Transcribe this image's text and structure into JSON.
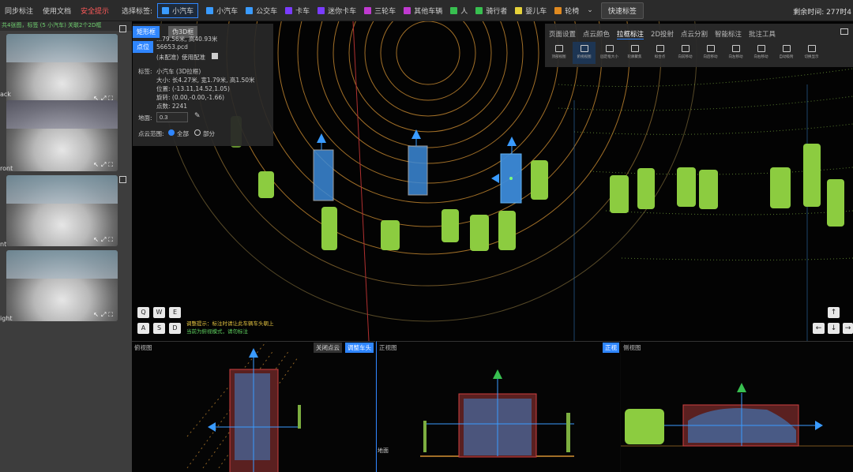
{
  "topbar": {
    "links": [
      "同步标注",
      "使用文档",
      "安全提示"
    ],
    "select_label": "选择标签:",
    "tags": [
      {
        "label": "小汽车",
        "color": "#3a9bff",
        "active": true
      },
      {
        "label": "小汽车",
        "color": "#3a9bff",
        "active": false
      },
      {
        "label": "公交车",
        "color": "#3a9bff",
        "active": false
      },
      {
        "label": "卡车",
        "color": "#7a3cff",
        "active": false
      },
      {
        "label": "迷你卡车",
        "color": "#7a3cff",
        "active": false
      },
      {
        "label": "三轮车",
        "color": "#c03ad0",
        "active": false
      },
      {
        "label": "其他车辆",
        "color": "#c03ad0",
        "active": false
      },
      {
        "label": "人",
        "color": "#38c050",
        "active": false
      },
      {
        "label": "骑行者",
        "color": "#38c050",
        "active": false
      },
      {
        "label": "婴儿车",
        "color": "#e6d23a",
        "active": false
      },
      {
        "label": "轮椅",
        "color": "#e08a20",
        "active": false
      }
    ],
    "quick_tag": "快速标签",
    "remaining": "剩余时间: 277时4"
  },
  "left": {
    "header": "共4张图，标签 (5 小汽车) 关联2个2D框",
    "cameras": [
      {
        "label": "ack"
      },
      {
        "label": "ront"
      },
      {
        "label": "nt"
      },
      {
        "label": "ight"
      }
    ]
  },
  "info": {
    "tab_rect": "矩形框",
    "tab_3d": "伪3D框",
    "tab_point": "点位",
    "dims": "...79.56米, 高40.93米",
    "file": "56653.pcd",
    "unmatched": "(未配准)",
    "use_match": "使用配准",
    "tag_label": "标签:",
    "tag_value": "小汽车 (3D拉框)",
    "size": "大小: 长4.27米, 宽1.79米, 高1.50米",
    "position": "位置: (-13.11,14.52,1.05)",
    "rotation": "旋转: (0.00,-0.00,-1.66)",
    "points": "点数: 2241",
    "ground_label": "地面:",
    "ground_value": "0.3",
    "range_label": "点云范围:",
    "range_all": "全部",
    "range_part": "部分"
  },
  "tools": {
    "tabs": [
      "页面设置",
      "点云颜色",
      "拉框标注",
      "2D投射",
      "点云分割",
      "智能标注",
      "批注工具"
    ],
    "items": [
      "顶部视图",
      "俯视视图",
      "固定框大小",
      "轮廓聚焦",
      "拟合点",
      "向前移动",
      "向后移动",
      "向左移动",
      "向右移动",
      "自动吸附",
      "切换显示"
    ]
  },
  "keys": [
    "Q",
    "W",
    "E",
    "A",
    "S",
    "D"
  ],
  "arrow_keys": [
    "↑",
    "←",
    "↓",
    "→"
  ],
  "hint": [
    "调整提示：标注时请让此车辆车头朝上",
    "当前为俯视模式，请勿标注"
  ],
  "views": {
    "top": {
      "title": "俯视图",
      "badge1": "关闭点云",
      "badge2": "调整车头"
    },
    "front": {
      "title": "正视图",
      "badge": "正视"
    },
    "side": {
      "title": "侧视图"
    },
    "ground": "地面"
  }
}
